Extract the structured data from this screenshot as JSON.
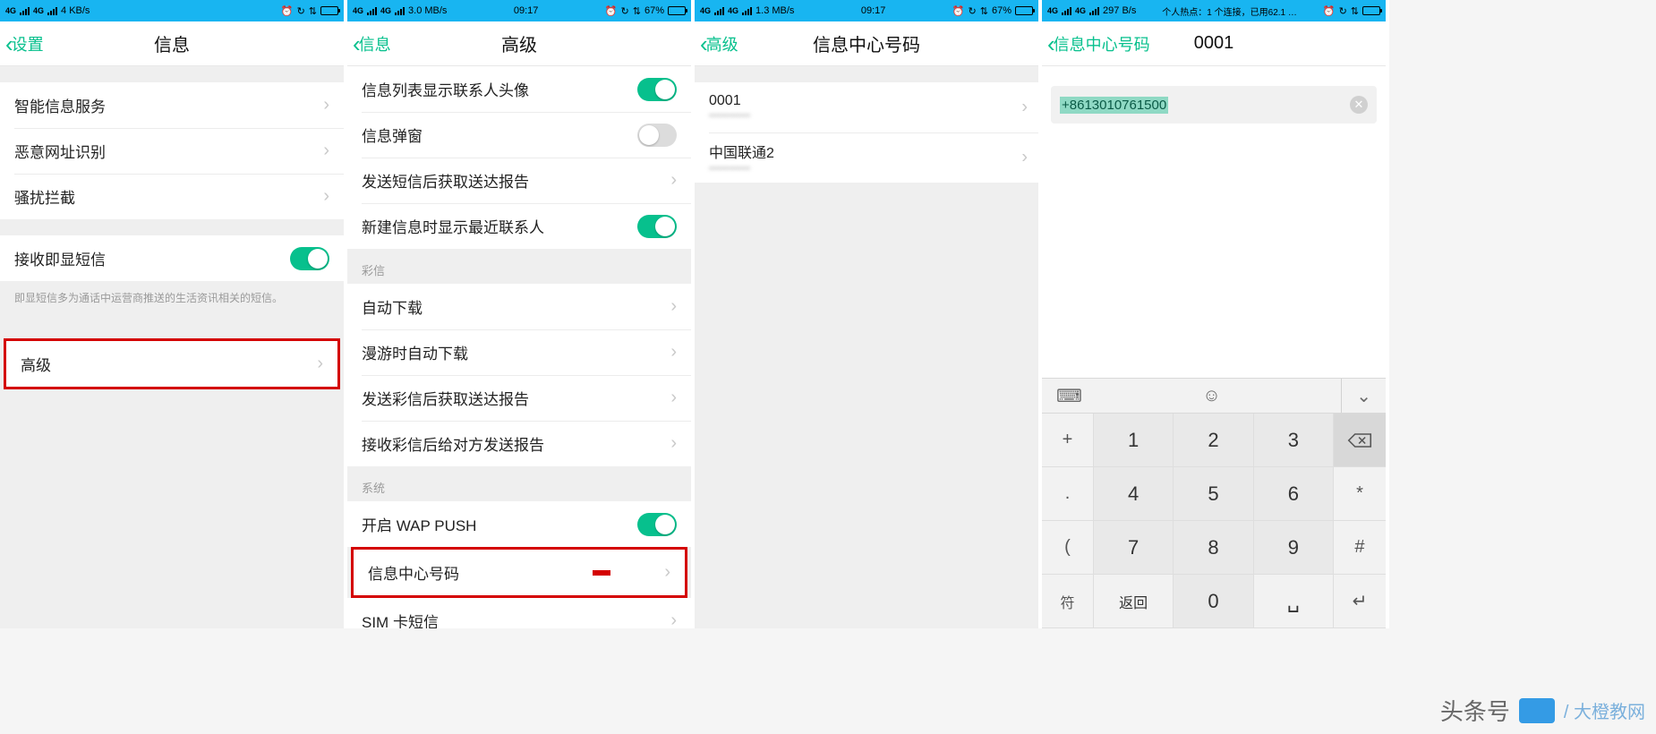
{
  "screens": [
    {
      "status": {
        "left": "4 KB/s",
        "center": "",
        "right_icons": [
          "alarm",
          "nfc",
          "bt"
        ],
        "battery": 100
      },
      "nav": {
        "back": "设置",
        "title": "信息"
      },
      "group1": [
        {
          "label": "智能信息服务",
          "type": "arrow"
        },
        {
          "label": "恶意网址识别",
          "type": "arrow"
        },
        {
          "label": "骚扰拦截",
          "type": "arrow"
        }
      ],
      "group2": [
        {
          "label": "接收即显短信",
          "type": "toggle",
          "on": true
        }
      ],
      "desc": "即显短信多为通话中运营商推送的生活资讯相关的短信。",
      "group3": [
        {
          "label": "高级",
          "type": "arrow",
          "highlight": true
        }
      ]
    },
    {
      "status": {
        "left": "3.0 MB/s",
        "center": "09:17",
        "right": "67%",
        "battery": 67
      },
      "nav": {
        "back": "信息",
        "title": "高级"
      },
      "group1": [
        {
          "label": "信息列表显示联系人头像",
          "type": "toggle",
          "on": true
        },
        {
          "label": "信息弹窗",
          "type": "toggle",
          "on": false
        },
        {
          "label": "发送短信后获取送达报告",
          "type": "arrow"
        },
        {
          "label": "新建信息时显示最近联系人",
          "type": "toggle",
          "on": true
        }
      ],
      "sect2": "彩信",
      "group2": [
        {
          "label": "自动下载",
          "type": "arrow"
        },
        {
          "label": "漫游时自动下载",
          "type": "arrow"
        },
        {
          "label": "发送彩信后获取送达报告",
          "type": "arrow"
        },
        {
          "label": "接收彩信后给对方发送报告",
          "type": "arrow"
        }
      ],
      "sect3": "系统",
      "group3": [
        {
          "label": "开启 WAP PUSH",
          "type": "toggle",
          "on": true
        },
        {
          "label": "信息中心号码",
          "type": "arrow",
          "highlight": true
        },
        {
          "label": "SIM 卡短信",
          "type": "arrow"
        }
      ]
    },
    {
      "status": {
        "left": "1.3 MB/s",
        "center": "09:17",
        "right": "67%",
        "battery": 67
      },
      "nav": {
        "back": "高级",
        "title": "信息中心号码"
      },
      "sims": [
        {
          "name": "0001",
          "sub": "•••••••••••"
        },
        {
          "name": "中国联通2",
          "sub": "•••••••••••"
        }
      ]
    },
    {
      "status": {
        "left": "297 B/s",
        "center": "个人热点：1 个连接，已用62.1 …",
        "right_icons": [
          "alarm",
          "nfc",
          "bt"
        ],
        "battery": 100
      },
      "nav": {
        "back": "信息中心号码",
        "title": "0001"
      },
      "field": {
        "value": "+8613010761500"
      },
      "keypad": {
        "rows": [
          [
            "+",
            "1",
            "2",
            "3",
            "⌫"
          ],
          [
            ",",
            "4",
            "5",
            "6",
            "*"
          ],
          [
            "(",
            "7",
            "8",
            "9",
            "#"
          ],
          [
            "符",
            "返回",
            "0",
            "␣",
            "↵"
          ]
        ],
        "bottom": {
          "sym": "符",
          "back": "返回",
          "zero": "0"
        }
      }
    }
  ],
  "watermark": {
    "left": "头条号",
    "right": "/ 大橙教网"
  }
}
